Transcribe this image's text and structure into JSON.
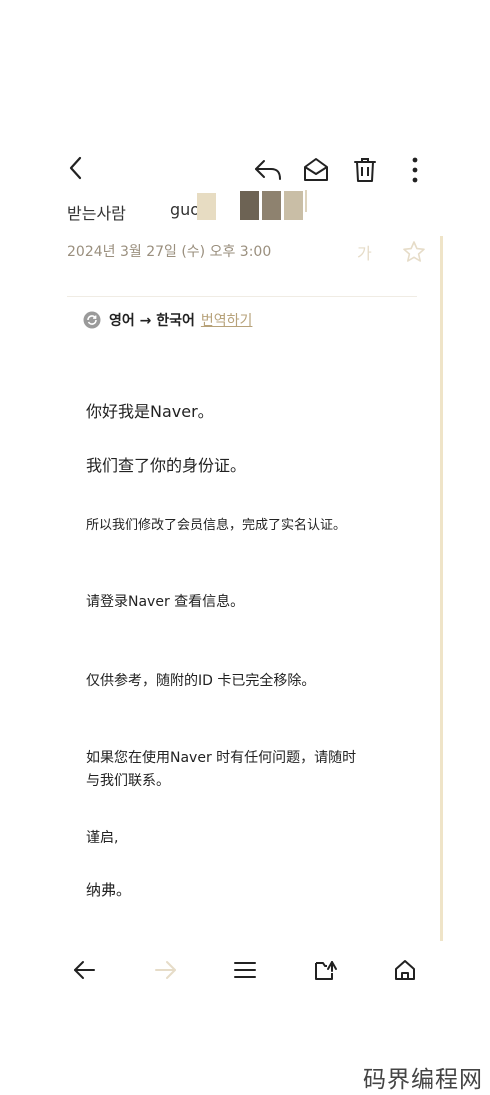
{
  "header": {
    "back_icon": "chevron-left-icon",
    "reply_icon": "reply-icon",
    "mark_unread_icon": "envelope-open-icon",
    "delete_icon": "trash-icon",
    "more_icon": "more-vertical-icon"
  },
  "recipient": {
    "label": "받는사람",
    "value": "guoj"
  },
  "date": "2024년 3월 27일 (수) 오후 3:00",
  "font_size_label": "가",
  "translate": {
    "languages": "영어 → 한국어",
    "action": "번역하기"
  },
  "body": {
    "greeting": "你好我是Naver。",
    "line1": "我们查了你的身份证。",
    "line2": "所以我们修改了会员信息，完成了实名认证。",
    "line3": "请登录Naver 查看信息。",
    "line4": "仅供参考，随附的ID 卡已完全移除。",
    "line5a": "如果您在使用Naver 时有任何问题，请随时",
    "line5b": "与我们联系。",
    "closing": "谨启,",
    "signature": "纳弗。"
  },
  "bottom_nav": {
    "prev_icon": "arrow-left-icon",
    "next_icon": "arrow-right-icon",
    "list_icon": "menu-icon",
    "move_icon": "folder-move-icon",
    "home_icon": "home-icon"
  },
  "watermark": "码界编程网",
  "colors": {
    "accent": "#b7a27a",
    "muted": "#9a8f7e",
    "divider": "#efe4c8",
    "disabled": "#e6dcc8"
  }
}
